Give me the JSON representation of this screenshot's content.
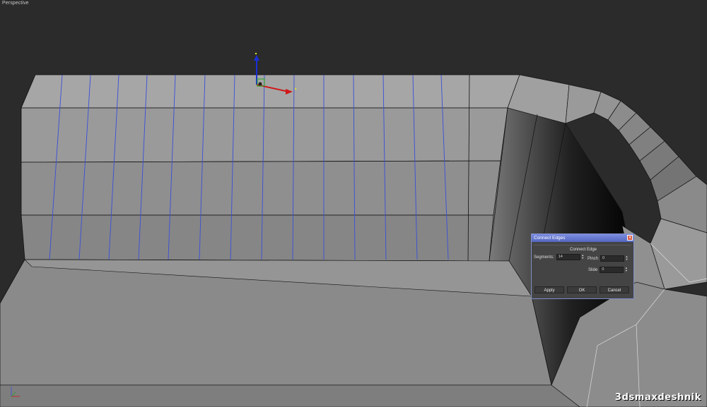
{
  "viewport": {
    "label": "Perspective",
    "gizmo_axes": {
      "x_color": "#d01818",
      "z_color": "#1a2fd6",
      "y_color": "#1fa81f"
    }
  },
  "dialog": {
    "title": "Connect Edges",
    "group_label": "Connect Edge",
    "segments_label": "Segments:",
    "segments_value": "14",
    "pinch_label": "Pinch",
    "pinch_value": "0",
    "slide_label": "Slide",
    "slide_value": "0",
    "apply_label": "Apply",
    "ok_label": "OK",
    "cancel_label": "Cancel",
    "close_icon": "close-icon"
  },
  "watermark": "3dsmaxdeshnik",
  "colors": {
    "background": "#2b2b2b",
    "mesh_light": "#9c9c9c",
    "mesh_mid": "#8a8a8a",
    "edge_selected": "#3a4fd8",
    "dialog_title": "#6070d0"
  }
}
